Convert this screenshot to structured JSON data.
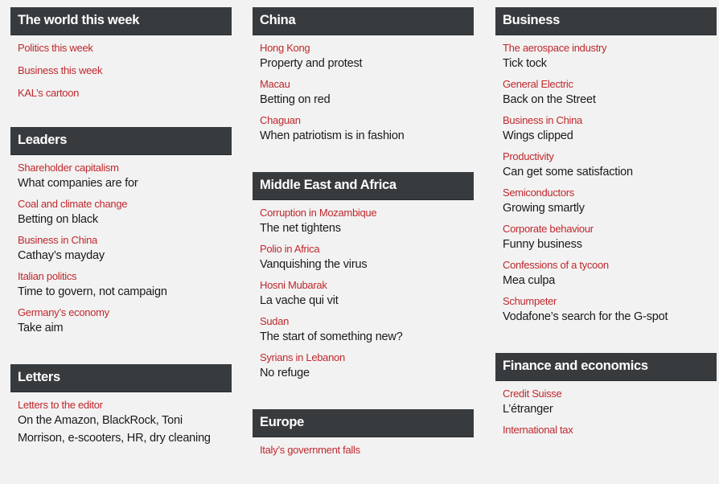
{
  "columns": [
    {
      "sections": [
        {
          "title": "The world this week",
          "items": [
            {
              "rubric": "Politics this week"
            },
            {
              "rubric": "Business this week"
            },
            {
              "rubric": "KAL’s cartoon"
            }
          ]
        },
        {
          "title": "Leaders",
          "items": [
            {
              "rubric": "Shareholder capitalism",
              "headline": "What companies are for"
            },
            {
              "rubric": "Coal and climate change",
              "headline": "Betting on black"
            },
            {
              "rubric": "Business in China",
              "headline": "Cathay’s mayday"
            },
            {
              "rubric": "Italian politics",
              "headline": "Time to govern, not campaign"
            },
            {
              "rubric": "Germany’s economy",
              "headline": "Take aim"
            }
          ]
        },
        {
          "title": "Letters",
          "items": [
            {
              "rubric": "Letters to the editor",
              "headline": "On the Amazon, BlackRock, Toni Morrison, e-scooters, HR, dry cleaning"
            }
          ]
        }
      ]
    },
    {
      "sections": [
        {
          "title": "China",
          "items": [
            {
              "rubric": "Hong Kong",
              "headline": "Property and protest"
            },
            {
              "rubric": "Macau",
              "headline": "Betting on red"
            },
            {
              "rubric": "Chaguan",
              "headline": "When patriotism is in fashion"
            }
          ]
        },
        {
          "title": "Middle East and Africa",
          "items": [
            {
              "rubric": "Corruption in Mozambique",
              "headline": "The net tightens"
            },
            {
              "rubric": "Polio in Africa",
              "headline": "Vanquishing the virus"
            },
            {
              "rubric": "Hosni Mubarak",
              "headline": "La vache qui vit"
            },
            {
              "rubric": "Sudan",
              "headline": "The start of something new?"
            },
            {
              "rubric": "Syrians in Lebanon",
              "headline": "No refuge"
            }
          ]
        },
        {
          "title": "Europe",
          "items": [
            {
              "rubric": "Italy’s government falls"
            }
          ]
        }
      ]
    },
    {
      "sections": [
        {
          "title": "Business",
          "items": [
            {
              "rubric": "The aerospace industry",
              "headline": "Tick tock"
            },
            {
              "rubric": "General Electric",
              "headline": "Back on the Street"
            },
            {
              "rubric": "Business in China",
              "headline": "Wings clipped"
            },
            {
              "rubric": "Productivity",
              "headline": "Can get some satisfaction"
            },
            {
              "rubric": "Semiconductors",
              "headline": "Growing smartly"
            },
            {
              "rubric": "Corporate behaviour",
              "headline": "Funny business"
            },
            {
              "rubric": "Confessions of a tycoon",
              "headline": "Mea culpa"
            },
            {
              "rubric": "Schumpeter",
              "headline": "Vodafone’s search for the G-spot"
            }
          ]
        },
        {
          "title": "Finance and economics",
          "items": [
            {
              "rubric": "Credit Suisse",
              "headline": "L’étranger"
            },
            {
              "rubric": "International tax"
            }
          ]
        }
      ]
    }
  ],
  "colors": {
    "header_bg": "#383b3e",
    "rubric": "#c0282d",
    "headline": "#1a1a1a",
    "page_bg": "#f2f2f2"
  }
}
